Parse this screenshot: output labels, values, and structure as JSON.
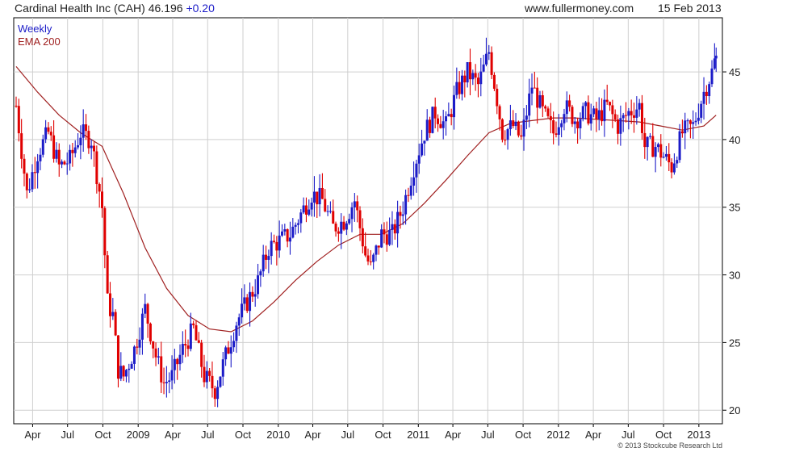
{
  "header": {
    "name": "Cardinal Health Inc (CAH)",
    "price": "46.196",
    "change": "+0.20",
    "site": "www.fullermoney.com",
    "date": "15 Feb 2013"
  },
  "copyright": "© 2013 Stockcube Research Ltd",
  "colors": {
    "up": "#1c1cc8",
    "down": "#e00000",
    "ema": "#a02020",
    "grid": "#cfcfcf",
    "axis": "#000000"
  },
  "chart_data": {
    "type": "line",
    "title": "Cardinal Health Inc (CAH)",
    "ylim": [
      19,
      49
    ],
    "yticks": [
      20,
      25,
      30,
      35,
      40,
      45
    ],
    "grid": true,
    "legend_position": "top-left",
    "xticks": [
      {
        "label": "Apr",
        "date": "2008-04-01"
      },
      {
        "label": "Jul",
        "date": "2008-07-01"
      },
      {
        "label": "Oct",
        "date": "2008-10-01"
      },
      {
        "label": "2009",
        "date": "2009-01-01"
      },
      {
        "label": "Apr",
        "date": "2009-04-01"
      },
      {
        "label": "Jul",
        "date": "2009-07-01"
      },
      {
        "label": "Oct",
        "date": "2009-10-01"
      },
      {
        "label": "2010",
        "date": "2010-01-01"
      },
      {
        "label": "Apr",
        "date": "2010-04-01"
      },
      {
        "label": "Jul",
        "date": "2010-07-01"
      },
      {
        "label": "Oct",
        "date": "2010-10-01"
      },
      {
        "label": "2011",
        "date": "2011-01-01"
      },
      {
        "label": "Apr",
        "date": "2011-04-01"
      },
      {
        "label": "Jul",
        "date": "2011-07-01"
      },
      {
        "label": "Oct",
        "date": "2011-10-01"
      },
      {
        "label": "2012",
        "date": "2012-01-01"
      },
      {
        "label": "Apr",
        "date": "2012-04-01"
      },
      {
        "label": "Jul",
        "date": "2012-07-01"
      },
      {
        "label": "Oct",
        "date": "2012-10-01"
      },
      {
        "label": "2013",
        "date": "2013-01-01"
      }
    ],
    "x_range": [
      "2008-02-18",
      "2013-02-25"
    ],
    "series": [
      {
        "name": "Weekly",
        "kind": "price-bars",
        "points": [
          {
            "date": "2008-02-18",
            "close": 42.5
          },
          {
            "date": "2008-03-17",
            "close": 36.0
          },
          {
            "date": "2008-04-14",
            "close": 39.0
          },
          {
            "date": "2008-05-12",
            "close": 40.5
          },
          {
            "date": "2008-06-09",
            "close": 38.0
          },
          {
            "date": "2008-07-07",
            "close": 38.5
          },
          {
            "date": "2008-08-04",
            "close": 40.5
          },
          {
            "date": "2008-09-01",
            "close": 40.0
          },
          {
            "date": "2008-09-29",
            "close": 35.0
          },
          {
            "date": "2008-10-13",
            "close": 28.0
          },
          {
            "date": "2008-10-27",
            "close": 27.0
          },
          {
            "date": "2008-11-10",
            "close": 23.0
          },
          {
            "date": "2008-11-24",
            "close": 22.5
          },
          {
            "date": "2008-12-22",
            "close": 24.5
          },
          {
            "date": "2009-01-19",
            "close": 27.5
          },
          {
            "date": "2009-02-16",
            "close": 24.0
          },
          {
            "date": "2009-03-09",
            "close": 22.0
          },
          {
            "date": "2009-03-30",
            "close": 22.5
          },
          {
            "date": "2009-04-27",
            "close": 24.5
          },
          {
            "date": "2009-05-25",
            "close": 26.0
          },
          {
            "date": "2009-06-22",
            "close": 22.5
          },
          {
            "date": "2009-07-20",
            "close": 21.5
          },
          {
            "date": "2009-08-17",
            "close": 24.0
          },
          {
            "date": "2009-09-14",
            "close": 26.5
          },
          {
            "date": "2009-10-12",
            "close": 28.0
          },
          {
            "date": "2009-11-09",
            "close": 29.5
          },
          {
            "date": "2009-12-07",
            "close": 32.0
          },
          {
            "date": "2010-01-04",
            "close": 32.5
          },
          {
            "date": "2010-02-01",
            "close": 33.0
          },
          {
            "date": "2010-03-01",
            "close": 34.5
          },
          {
            "date": "2010-03-29",
            "close": 36.0
          },
          {
            "date": "2010-04-26",
            "close": 35.5
          },
          {
            "date": "2010-05-24",
            "close": 33.5
          },
          {
            "date": "2010-06-21",
            "close": 34.0
          },
          {
            "date": "2010-07-19",
            "close": 35.5
          },
          {
            "date": "2010-08-16",
            "close": 31.5
          },
          {
            "date": "2010-08-30",
            "close": 30.5
          },
          {
            "date": "2010-09-27",
            "close": 33.0
          },
          {
            "date": "2010-10-25",
            "close": 33.0
          },
          {
            "date": "2010-11-22",
            "close": 35.0
          },
          {
            "date": "2010-12-20",
            "close": 38.0
          },
          {
            "date": "2011-01-17",
            "close": 40.5
          },
          {
            "date": "2011-02-14",
            "close": 42.0
          },
          {
            "date": "2011-03-14",
            "close": 41.0
          },
          {
            "date": "2011-04-11",
            "close": 43.5
          },
          {
            "date": "2011-05-09",
            "close": 45.0
          },
          {
            "date": "2011-06-06",
            "close": 44.0
          },
          {
            "date": "2011-07-04",
            "close": 46.5
          },
          {
            "date": "2011-07-25",
            "close": 43.0
          },
          {
            "date": "2011-08-08",
            "close": 40.5
          },
          {
            "date": "2011-09-05",
            "close": 41.0
          },
          {
            "date": "2011-09-26",
            "close": 40.0
          },
          {
            "date": "2011-10-24",
            "close": 44.0
          },
          {
            "date": "2011-11-21",
            "close": 42.0
          },
          {
            "date": "2011-12-19",
            "close": 40.5
          },
          {
            "date": "2012-01-16",
            "close": 42.5
          },
          {
            "date": "2012-02-13",
            "close": 41.5
          },
          {
            "date": "2012-03-12",
            "close": 42.0
          },
          {
            "date": "2012-04-09",
            "close": 41.5
          },
          {
            "date": "2012-05-07",
            "close": 42.5
          },
          {
            "date": "2012-06-04",
            "close": 41.0
          },
          {
            "date": "2012-07-02",
            "close": 42.0
          },
          {
            "date": "2012-07-30",
            "close": 42.5
          },
          {
            "date": "2012-08-13",
            "close": 39.5
          },
          {
            "date": "2012-09-10",
            "close": 39.5
          },
          {
            "date": "2012-10-08",
            "close": 38.5
          },
          {
            "date": "2012-10-22",
            "close": 38.0
          },
          {
            "date": "2012-11-19",
            "close": 40.5
          },
          {
            "date": "2012-12-17",
            "close": 41.0
          },
          {
            "date": "2013-01-14",
            "close": 43.5
          },
          {
            "date": "2013-02-04",
            "close": 45.0
          },
          {
            "date": "2013-02-15",
            "close": 46.2
          }
        ]
      },
      {
        "name": "EMA 200",
        "kind": "line",
        "points": [
          {
            "date": "2008-02-18",
            "value": 45.4
          },
          {
            "date": "2008-04-14",
            "value": 43.5
          },
          {
            "date": "2008-06-09",
            "value": 41.8
          },
          {
            "date": "2008-08-04",
            "value": 40.5
          },
          {
            "date": "2008-09-29",
            "value": 39.5
          },
          {
            "date": "2008-11-24",
            "value": 36.0
          },
          {
            "date": "2009-01-19",
            "value": 32.0
          },
          {
            "date": "2009-03-16",
            "value": 29.0
          },
          {
            "date": "2009-05-11",
            "value": 27.0
          },
          {
            "date": "2009-07-06",
            "value": 26.0
          },
          {
            "date": "2009-08-31",
            "value": 25.8
          },
          {
            "date": "2009-10-26",
            "value": 26.6
          },
          {
            "date": "2009-12-21",
            "value": 28.0
          },
          {
            "date": "2010-02-15",
            "value": 29.6
          },
          {
            "date": "2010-04-12",
            "value": 31.0
          },
          {
            "date": "2010-06-07",
            "value": 32.2
          },
          {
            "date": "2010-08-02",
            "value": 33.0
          },
          {
            "date": "2010-09-27",
            "value": 33.0
          },
          {
            "date": "2010-11-22",
            "value": 33.8
          },
          {
            "date": "2011-01-17",
            "value": 35.3
          },
          {
            "date": "2011-03-14",
            "value": 37.0
          },
          {
            "date": "2011-05-09",
            "value": 38.8
          },
          {
            "date": "2011-07-04",
            "value": 40.5
          },
          {
            "date": "2011-08-29",
            "value": 41.2
          },
          {
            "date": "2011-10-24",
            "value": 41.4
          },
          {
            "date": "2011-12-19",
            "value": 41.6
          },
          {
            "date": "2012-02-13",
            "value": 41.6
          },
          {
            "date": "2012-04-09",
            "value": 41.5
          },
          {
            "date": "2012-06-04",
            "value": 41.4
          },
          {
            "date": "2012-07-30",
            "value": 41.3
          },
          {
            "date": "2012-09-24",
            "value": 41.0
          },
          {
            "date": "2012-11-19",
            "value": 40.7
          },
          {
            "date": "2013-01-14",
            "value": 41.0
          },
          {
            "date": "2013-02-15",
            "value": 41.8
          }
        ]
      }
    ]
  }
}
